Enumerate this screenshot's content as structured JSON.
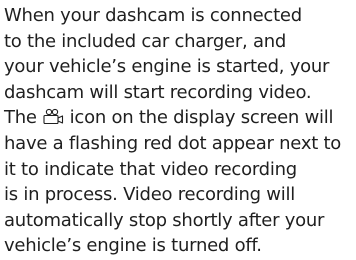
{
  "doc": {
    "lines": [
      "When your dashcam is connected",
      "to the included car charger, and",
      "your vehicle’s engine is started, your",
      "dashcam will start recording video.",
      null,
      "have a flashing red dot appear next to",
      "it to indicate that video recording",
      "is in process. Video recording will",
      "automatically stop shortly after your",
      "vehicle’s engine is turned off."
    ],
    "line5_before_icon": "The ",
    "line5_after_icon": " icon on the display screen will",
    "icon": "video-camera-icon"
  }
}
